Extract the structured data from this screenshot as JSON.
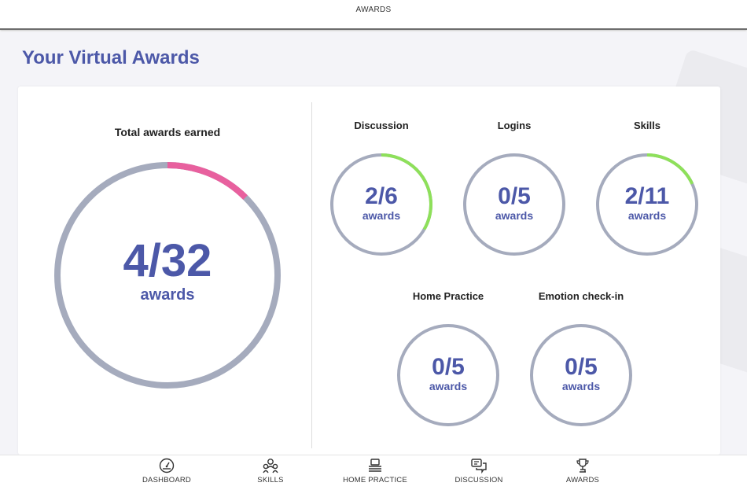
{
  "app": {
    "top_title": "AWARDS"
  },
  "page": {
    "title": "Your Virtual Awards"
  },
  "total": {
    "label": "Total awards earned",
    "earned": 4,
    "total": 32,
    "fraction_text": "4/32",
    "unit": "awards"
  },
  "categories": [
    {
      "label": "Discussion",
      "earned": 2,
      "total": 6,
      "fraction_text": "2/6",
      "unit": "awards"
    },
    {
      "label": "Logins",
      "earned": 0,
      "total": 5,
      "fraction_text": "0/5",
      "unit": "awards"
    },
    {
      "label": "Skills",
      "earned": 2,
      "total": 11,
      "fraction_text": "2/11",
      "unit": "awards"
    },
    {
      "label": "Home Practice",
      "earned": 0,
      "total": 5,
      "fraction_text": "0/5",
      "unit": "awards"
    },
    {
      "label": "Emotion check-in",
      "earned": 0,
      "total": 5,
      "fraction_text": "0/5",
      "unit": "awards"
    }
  ],
  "nav": {
    "items": [
      {
        "label": "DASHBOARD",
        "icon": "gauge-icon"
      },
      {
        "label": "SKILLS",
        "icon": "people-icon"
      },
      {
        "label": "HOME PRACTICE",
        "icon": "laptop-stack-icon"
      },
      {
        "label": "DISCUSSION",
        "icon": "chat-bubbles-icon"
      },
      {
        "label": "AWARDS",
        "icon": "trophy-icon"
      }
    ]
  },
  "colors": {
    "accent": "#4c58a8",
    "ring_track": "#a5abbd",
    "total_progress": "#e8609e",
    "category_progress": "#8ee05a"
  }
}
